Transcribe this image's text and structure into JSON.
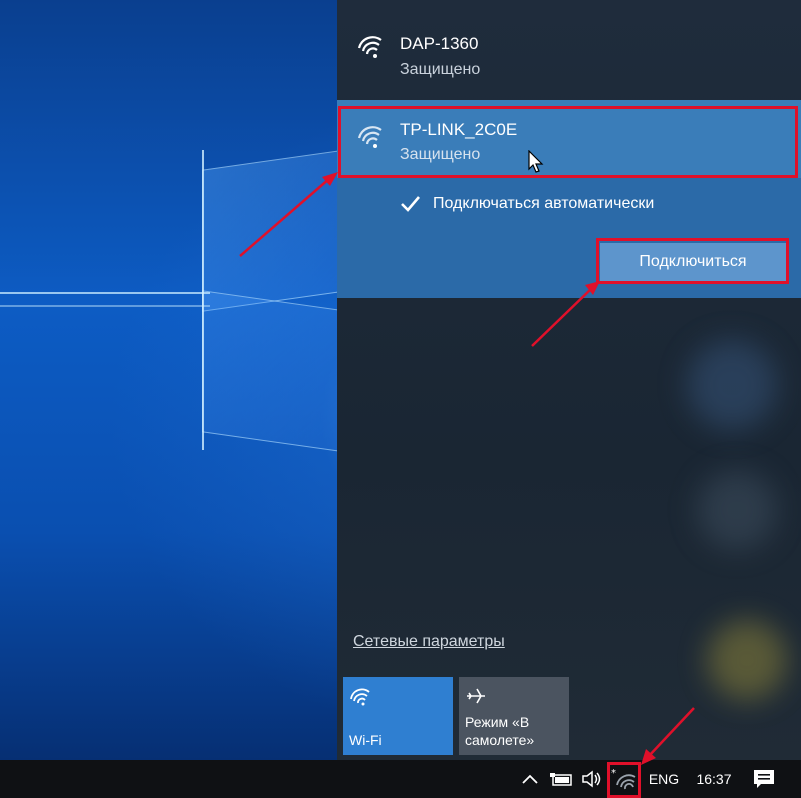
{
  "flyout": {
    "networks": [
      {
        "ssid": "DAP-1360",
        "status": "Защищено"
      },
      {
        "ssid": "TP-LINK_2C0E",
        "status": "Защищено"
      }
    ],
    "auto_connect": {
      "label": "Подключаться автоматически",
      "checked": true
    },
    "connect_button": "Подключиться",
    "network_settings_link": "Сетевые параметры",
    "quick_actions": [
      {
        "label": "Wi-Fi",
        "icon": "wifi-icon",
        "active": true
      },
      {
        "label": "Режим «В самолете»",
        "icon": "airplane-icon",
        "active": false
      }
    ]
  },
  "taskbar": {
    "language": "ENG",
    "time": "16:37"
  },
  "colors": {
    "highlight": "#e0102a",
    "accent": "#2f7fd1",
    "selected_bg": "#3a7db9"
  }
}
